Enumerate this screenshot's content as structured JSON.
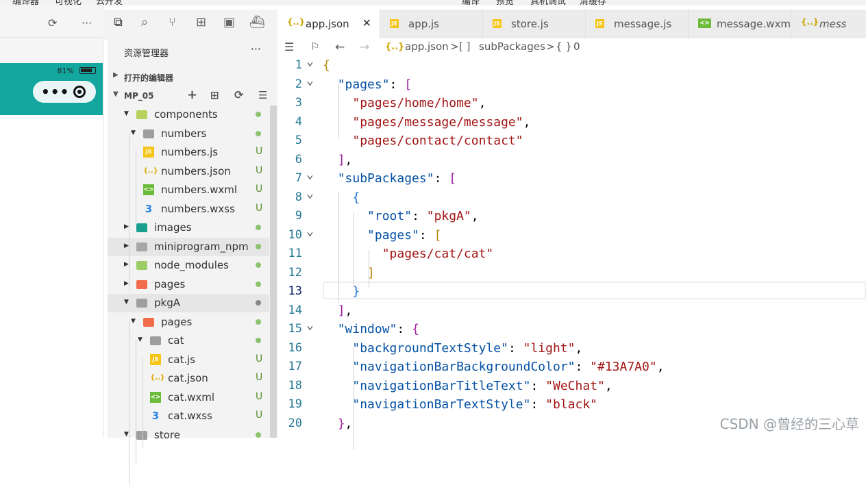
{
  "menubar": [
    "编译器",
    "可视化",
    "云开发",
    "编译",
    "预览",
    "真机调试",
    "清缓存"
  ],
  "simulator": {
    "battery_text": "81%",
    "battery_level": 0.81,
    "nav_color": "#13A7A0",
    "capsule_menu": "•••"
  },
  "explorer": {
    "title": "资源管理器",
    "more": "···",
    "open_editors": "打开的编辑器",
    "project": "MP_05",
    "tree": [
      {
        "name": "components",
        "depth": 1,
        "kind": "folder",
        "open": true,
        "status": "dot"
      },
      {
        "name": "numbers",
        "depth": 2,
        "kind": "folder",
        "open": true,
        "status": "dot"
      },
      {
        "name": "numbers.js",
        "depth": 3,
        "kind": "js",
        "status": "U"
      },
      {
        "name": "numbers.json",
        "depth": 3,
        "kind": "json",
        "status": "U"
      },
      {
        "name": "numbers.wxml",
        "depth": 3,
        "kind": "wxml",
        "status": "U"
      },
      {
        "name": "numbers.wxss",
        "depth": 3,
        "kind": "wxss",
        "status": "U"
      },
      {
        "name": "images",
        "depth": 1,
        "kind": "folder",
        "open": false,
        "status": "dot"
      },
      {
        "name": "miniprogram_npm",
        "depth": 1,
        "kind": "folder",
        "open": false,
        "status": "dot"
      },
      {
        "name": "node_modules",
        "depth": 1,
        "kind": "folder",
        "open": false,
        "status": "dot"
      },
      {
        "name": "pages",
        "depth": 1,
        "kind": "folder",
        "open": false,
        "status": "dot"
      },
      {
        "name": "pkgA",
        "depth": 1,
        "kind": "folder",
        "open": true,
        "status": "dot"
      },
      {
        "name": "pages",
        "depth": 2,
        "kind": "folder",
        "open": true,
        "status": "dot"
      },
      {
        "name": "cat",
        "depth": 3,
        "kind": "folder",
        "open": true,
        "status": "dot"
      },
      {
        "name": "cat.js",
        "depth": 4,
        "kind": "js",
        "status": "U"
      },
      {
        "name": "cat.json",
        "depth": 4,
        "kind": "json",
        "status": "U"
      },
      {
        "name": "cat.wxml",
        "depth": 4,
        "kind": "wxml",
        "status": "U"
      },
      {
        "name": "cat.wxss",
        "depth": 4,
        "kind": "wxss",
        "status": "U"
      },
      {
        "name": "store",
        "depth": 1,
        "kind": "folder",
        "open": true,
        "status": "dot"
      }
    ]
  },
  "tabs": [
    {
      "label": "app.json",
      "icon": "{..}",
      "active": true,
      "close": "✕"
    },
    {
      "label": "app.js",
      "icon": "JS",
      "active": false
    },
    {
      "label": "store.js",
      "icon": "JS",
      "active": false
    },
    {
      "label": "message.js",
      "icon": "JS",
      "active": false
    },
    {
      "label": "message.wxml",
      "icon": "<>",
      "active": false
    },
    {
      "label": "mess",
      "icon": "{..}",
      "active": false
    }
  ],
  "breadcrumb": {
    "file_icon": "{..}",
    "file": "app.json",
    "sep": ">",
    "arr_icon": "[ ]",
    "subpackages": "subPackages",
    "obj_icon": "{ }",
    "index": "0"
  },
  "code": {
    "current_line": 13,
    "lines": [
      "{",
      "  \"pages\": [",
      "    \"pages/home/home\",",
      "    \"pages/message/message\",",
      "    \"pages/contact/contact\"",
      "  ],",
      "  \"subPackages\": [",
      "    {",
      "      \"root\": \"pkgA\",",
      "      \"pages\": [",
      "        \"pages/cat/cat\"",
      "      ]",
      "    }",
      "  ],",
      "  \"window\": {",
      "    \"backgroundTextStyle\": \"light\",",
      "    \"navigationBarBackgroundColor\": \"#13A7A0\",",
      "    \"navigationBarTitleText\": \"WeChat\",",
      "    \"navigationBarTextStyle\": \"black\"",
      "  },"
    ],
    "folds": [
      1,
      2,
      7,
      8,
      10,
      15
    ]
  },
  "watermark": "CSDN @曾经的三心草"
}
